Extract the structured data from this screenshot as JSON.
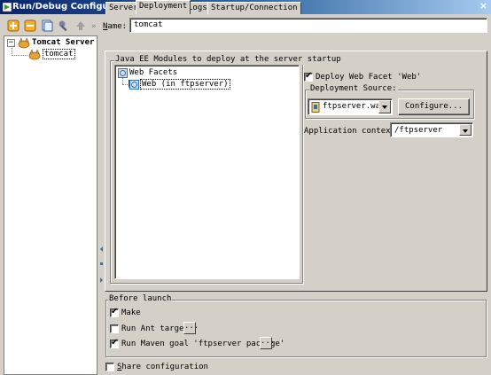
{
  "window": {
    "title": "Run/Debug Configurations",
    "close_glyph": "×"
  },
  "toolbar": {
    "buttons": [
      {
        "icon": "add-icon"
      },
      {
        "icon": "remove-icon"
      },
      {
        "icon": "copy-icon"
      },
      {
        "icon": "settings-wrench-icon"
      },
      {
        "icon": "move-up-icon"
      },
      {
        "icon": "more-icon",
        "glyph": "»"
      }
    ],
    "name_label_u": "N",
    "name_label_rest": "ame:",
    "name_value": "tomcat"
  },
  "tree": {
    "root": {
      "label": "Tomcat Server",
      "expander": "−"
    },
    "child": {
      "label": "tomcat"
    }
  },
  "tabs": [
    {
      "label": "Server"
    },
    {
      "label": "Deployment"
    },
    {
      "label": "Logs"
    },
    {
      "label": "Startup/Connection"
    }
  ],
  "deployment": {
    "modules_group_title": "Java EE Modules to deploy at the server startup",
    "modules": {
      "root": "Web Facets",
      "child": "Web (in ftpserver)"
    },
    "deploy_checkbox": {
      "checked": true,
      "label": "Deploy Web Facet 'Web'"
    },
    "source_group_title": "Deployment Source:",
    "source_value": "ftpserver.war",
    "configure_label": "Configure...",
    "app_context_label": "Application context:",
    "app_context_value": "/ftpserver"
  },
  "before_launch": {
    "title": "Before launch",
    "make": {
      "checked": true,
      "label": "Make"
    },
    "ant": {
      "checked": false,
      "label": "Run Ant target"
    },
    "maven": {
      "checked": true,
      "label": "Run Maven goal 'ftpserver package'"
    },
    "ellipsis": "..."
  },
  "share": {
    "checked": false,
    "label_u": "S",
    "label_rest": "hare configuration"
  },
  "check_glyph": "✔",
  "colors": {
    "titlebar_start": "#0a246a",
    "titlebar_end": "#a6caf0",
    "dialog_bg": "#d4d0c8",
    "tomcat_orange": "#e8a23c",
    "facet_blue": "#3a6ea5"
  }
}
